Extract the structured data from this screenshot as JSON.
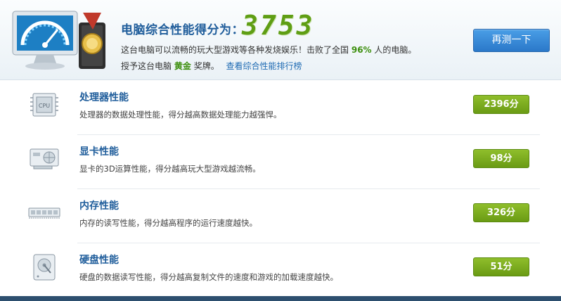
{
  "header": {
    "score_title": "电脑综合性能得分为：",
    "score_value": "3753",
    "line1_prefix": "这台电脑可以流畅的玩大型游戏等各种发烧娱乐！击败了全国",
    "line1_percent": "96%",
    "line1_suffix": "人的电脑。",
    "line2_prefix": "授予这台电脑",
    "line2_medal": "黄金",
    "line2_suffix": "奖牌。",
    "ranking_link": "查看综合性能排行榜",
    "retest_button": "再测一下"
  },
  "items": [
    {
      "title": "处理器性能",
      "desc": "处理器的数据处理性能，得分越高数据处理能力越强悍。",
      "score": "2396分",
      "icon": "cpu-icon"
    },
    {
      "title": "显卡性能",
      "desc": "显卡的3D运算性能，得分越高玩大型游戏越流畅。",
      "score": "98分",
      "icon": "graphics-card-icon"
    },
    {
      "title": "内存性能",
      "desc": "内存的读写性能，得分越高程序的运行速度越快。",
      "score": "326分",
      "icon": "memory-icon"
    },
    {
      "title": "硬盘性能",
      "desc": "硬盘的数据读写性能，得分越高复制文件的速度和游戏的加载速度越快。",
      "score": "51分",
      "icon": "hard-disk-icon"
    }
  ],
  "colors": {
    "accent_blue": "#1f5d9b",
    "score_green": "#6a9b14",
    "button_blue": "#2b78c9"
  }
}
